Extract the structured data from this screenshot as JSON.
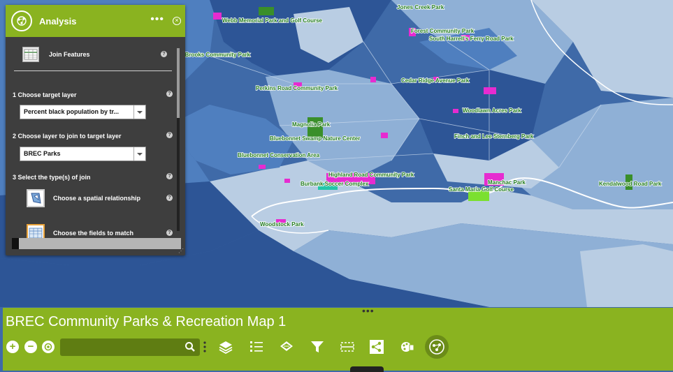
{
  "panel": {
    "title": "Analysis",
    "tool_name": "Join Features",
    "step1_label": "1 Choose target layer",
    "step1_value": "Percent black population by tr...",
    "step2_label": "2 Choose layer to join to target layer",
    "step2_value": "BREC Parks",
    "step3_label": "3 Select the type(s) of join",
    "option_spatial": "Choose a spatial relationship",
    "option_fields": "Choose the fields to match",
    "progress": 0.04
  },
  "map": {
    "park_labels": [
      "Webb Memorial Park and Golf Course",
      "Jones Creek Park",
      "Forest Community Park",
      "South Harrell's Ferry Road Park",
      "-Brooks Community Park",
      "Perkins Road Community Park",
      "Cedar Ridge Avenue Park",
      "Woodlawn Acres Park",
      "Magnolia Park",
      "Bluebonnet Swamp Nature Center",
      "Finch and Lee Sternberg Park",
      "Bluebonnet Conservation Area",
      "Highland Road Community Park",
      "Burbank Soccer Complex",
      "Manchac Park",
      "Santa Maria Golf Course",
      "Kendalwood Road Park",
      "Woodstock Park"
    ],
    "colors": {
      "dark": "#2d5596",
      "mid": "#4f7fbf",
      "light": "#8fb0d6",
      "pale": "#b9cde3",
      "park": "#e62bd0",
      "green": "#3a8f2a"
    }
  },
  "bottom_bar": {
    "title": "BREC Community Parks & Recreation Map 1",
    "search_placeholder": "",
    "accent": "#8ab320"
  }
}
